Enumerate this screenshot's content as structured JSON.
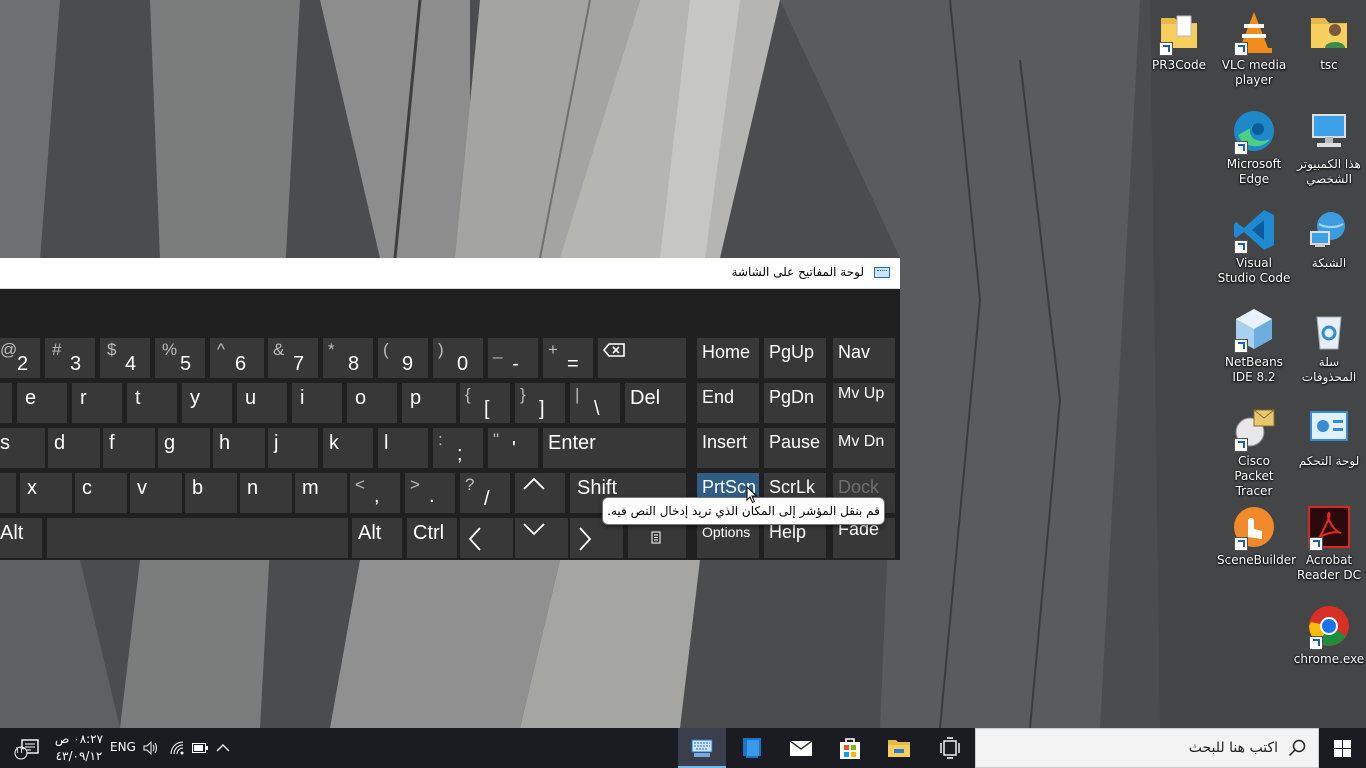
{
  "desktop": {
    "icons": [
      {
        "label": "PR3Code",
        "icon": "folder-icon"
      },
      {
        "label": "VLC media player",
        "icon": "vlc-icon"
      },
      {
        "label": "tsc",
        "icon": "user-folder-icon"
      },
      {
        "label": "Microsoft Edge",
        "icon": "edge-icon"
      },
      {
        "label": "هذا الكمبيوتر الشخصي",
        "icon": "this-pc-icon"
      },
      {
        "label": "Visual Studio Code",
        "icon": "vscode-icon"
      },
      {
        "label": "الشبكة",
        "icon": "network-icon"
      },
      {
        "label": "NetBeans IDE 8.2",
        "icon": "netbeans-icon"
      },
      {
        "label": "سلة المحذوفات",
        "icon": "recycle-bin-icon"
      },
      {
        "label": "Cisco Packet Tracer",
        "icon": "packet-tracer-icon"
      },
      {
        "label": "لوحة التحكم",
        "icon": "control-panel-icon"
      },
      {
        "label": "SceneBuilder",
        "icon": "scenebuilder-icon"
      },
      {
        "label": "Acrobat Reader DC",
        "icon": "acrobat-icon"
      },
      {
        "label": "chrome.exe",
        "icon": "chrome-icon"
      }
    ]
  },
  "osk": {
    "title": "لوحة المفاتيح على الشاشة",
    "rows": {
      "numbers": [
        {
          "sub": "@",
          "main": "2"
        },
        {
          "sub": "#",
          "main": "3"
        },
        {
          "sub": "$",
          "main": "4"
        },
        {
          "sub": "%",
          "main": "5"
        },
        {
          "sub": "^",
          "main": "6"
        },
        {
          "sub": "&",
          "main": "7"
        },
        {
          "sub": "*",
          "main": "8"
        },
        {
          "sub": "(",
          "main": "9"
        },
        {
          "sub": ")",
          "main": "0"
        },
        {
          "sub": "_",
          "main": "-"
        },
        {
          "sub": "+",
          "main": "="
        }
      ],
      "top": [
        {
          "main": "e"
        },
        {
          "main": "r"
        },
        {
          "main": "t"
        },
        {
          "main": "y"
        },
        {
          "main": "u"
        },
        {
          "main": "i"
        },
        {
          "main": "o"
        },
        {
          "main": "p"
        },
        {
          "sub": "{",
          "main": "["
        },
        {
          "sub": "}",
          "main": "]"
        },
        {
          "sub": "|",
          "main": "\\"
        }
      ],
      "home": [
        {
          "main": "s"
        },
        {
          "main": "d"
        },
        {
          "main": "f"
        },
        {
          "main": "g"
        },
        {
          "main": "h"
        },
        {
          "main": "j"
        },
        {
          "main": "k"
        },
        {
          "main": "l"
        },
        {
          "sub": ":",
          "main": ";"
        },
        {
          "sub": "\"",
          "main": "'"
        }
      ],
      "bottom": [
        {
          "main": "x"
        },
        {
          "main": "c"
        },
        {
          "main": "v"
        },
        {
          "main": "b"
        },
        {
          "main": "n"
        },
        {
          "main": "m"
        },
        {
          "sub": "<",
          "main": ","
        },
        {
          "sub": ">",
          "main": "."
        },
        {
          "sub": "?",
          "main": "/"
        }
      ]
    },
    "keys": {
      "del": "Del",
      "enter": "Enter",
      "shift": "Shift",
      "alt_left": "Alt",
      "alt_right": "Alt",
      "ctrl": "Ctrl",
      "home": "Home",
      "pgup": "PgUp",
      "nav": "Nav",
      "end": "End",
      "pgdn": "PgDn",
      "mvup": "Mv Up",
      "insert": "Insert",
      "pause": "Pause",
      "mvdn": "Mv Dn",
      "prtscn": "PrtScn",
      "scrlk": "ScrLk",
      "dock": "Dock",
      "options": "Options",
      "help": "Help",
      "fade": "Fade"
    },
    "tooltip": "قم بنقل المؤشر إلى المكان الذي تريد إدخال النص فيه."
  },
  "taskbar": {
    "search_placeholder": "اكتب هنا للبحث",
    "language": "ENG",
    "time": "٠٨:٢٧ ص",
    "date": "٤٣/٠٩/١٢",
    "notification_count": "١٣",
    "apps": [
      "osk-app-icon",
      "blue-app-icon",
      "mail-icon",
      "store-icon",
      "file-explorer-icon",
      "task-view-icon"
    ]
  },
  "colors": {
    "osk_bg": "#202020",
    "key_bg": "#383838",
    "key_highlight": "#2e5d85",
    "taskbar_bg": "#1b1c22",
    "taskbar_active": "#3a3f4b"
  }
}
